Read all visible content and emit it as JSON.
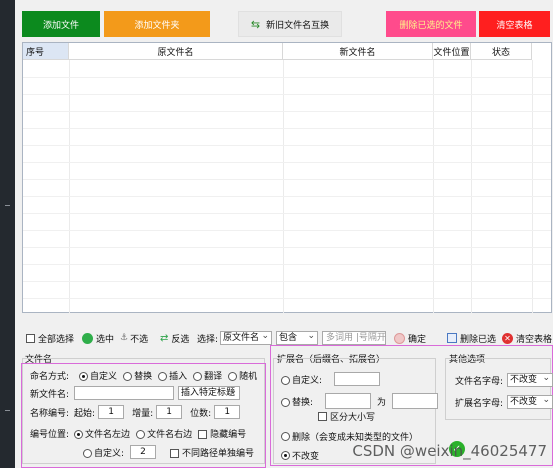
{
  "top_buttons": {
    "add_file": "添加文件",
    "add_folder": "添加文件夹",
    "swap_name": "新旧文件名互换",
    "delete_selected": "删除已选的文件",
    "clear_table": "清空表格"
  },
  "table": {
    "columns": [
      "序号",
      "原文件名",
      "新文件名",
      "文件位置",
      "状态"
    ]
  },
  "toolbar": {
    "select_all": "全部选择",
    "select": "选中",
    "deselect": "不选",
    "invert": "反选",
    "choose_label": "选择:",
    "field_select": "原文件名",
    "match_select": "包含",
    "keyword_placeholder": "多词用 |号隔开",
    "confirm": "确定",
    "delete_selected": "删除已选",
    "clear_table": "清空表格"
  },
  "filename_section": {
    "title": "文件名",
    "naming_mode_label": "命名方式:",
    "modes": [
      "自定义",
      "替换",
      "插入",
      "翻译",
      "随机"
    ],
    "new_name_label": "新文件名:",
    "insert_tag": "插入特定标题",
    "numbering_label": "名称编号:",
    "start_label": "起始:",
    "start_value": "1",
    "step_label": "增量:",
    "step_value": "1",
    "digits_label": "位数:",
    "digits_value": "1",
    "position_label": "编号位置:",
    "pos_left": "文件名左边",
    "pos_right": "文件名右边",
    "hide_number": "隐藏编号",
    "custom_label": "自定义:",
    "custom_value": "2",
    "separate_paths": "不同路径单独编号"
  },
  "extension_section": {
    "title": "扩展名（后缀名、拓展名）",
    "custom_label": "自定义:",
    "replace_label": "替换:",
    "as_label": "为",
    "case_sensitive": "区分大小写",
    "delete_label": "删除（会变成未知类型的文件）",
    "no_change": "不改变"
  },
  "other_section": {
    "title": "其他选项",
    "filename_case_label": "文件名字母:",
    "filename_case_value": "不改变",
    "ext_case_label": "扩展名字母:",
    "ext_case_value": "不改变"
  },
  "watermark": "CSDN @weixin_46025477"
}
